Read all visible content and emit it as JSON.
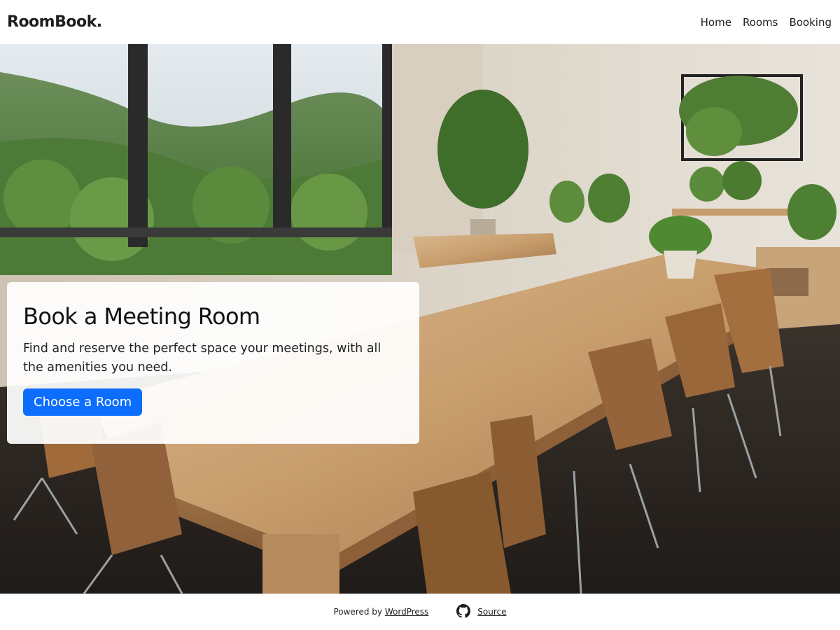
{
  "header": {
    "brand": "RoomBook.",
    "nav": [
      {
        "label": "Home"
      },
      {
        "label": "Rooms"
      },
      {
        "label": "Booking"
      }
    ]
  },
  "hero": {
    "image_name": "meeting-room-photo",
    "title": "Book a Meeting Room",
    "description": "Find and reserve the perfect space your meetings, with all the amenities you need.",
    "cta_label": "Choose a Room",
    "cta_color": "#0d6efd"
  },
  "footer": {
    "powered_prefix": "Powered by",
    "powered_link": "WordPress",
    "source_icon": "github-icon",
    "source_label": "Source"
  }
}
